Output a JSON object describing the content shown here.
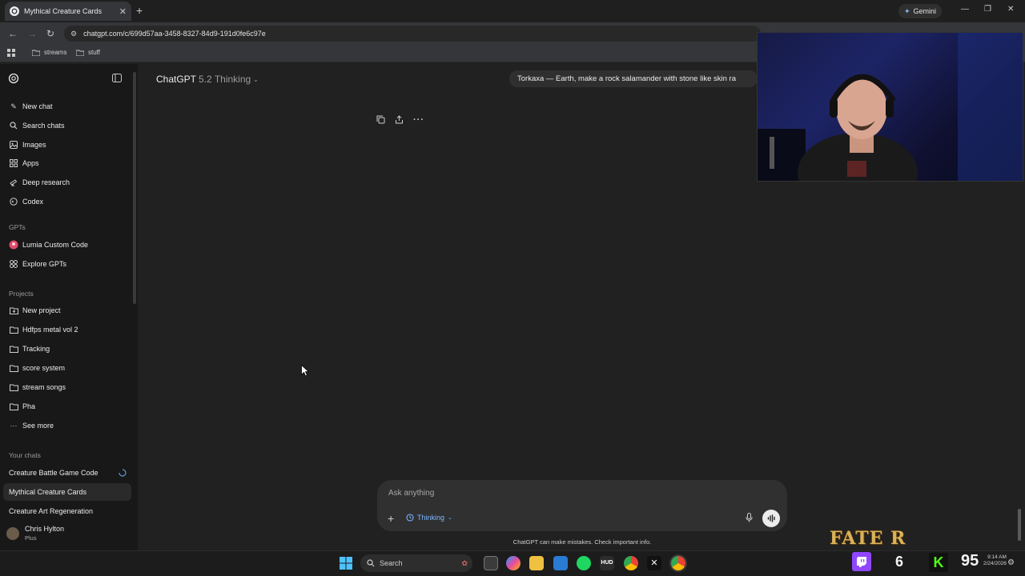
{
  "browser": {
    "tab_title": "Mythical Creature Cards",
    "gemini_label": "Gemini",
    "url": "chatgpt.com/c/699d57aa-3458-8327-84d9-191d0fe6c97e",
    "bookmarks": [
      "streams",
      "stuff"
    ]
  },
  "sidebar": {
    "nav": [
      {
        "label": "New chat",
        "icon": "edit-icon"
      },
      {
        "label": "Search chats",
        "icon": "search-icon"
      },
      {
        "label": "Images",
        "icon": "image-icon"
      },
      {
        "label": "Apps",
        "icon": "grid-icon"
      },
      {
        "label": "Deep research",
        "icon": "telescope-icon"
      },
      {
        "label": "Codex",
        "icon": "codex-icon"
      }
    ],
    "gpts_heading": "GPTs",
    "gpts": [
      {
        "label": "Lumia Custom Code",
        "icon": "lumia-icon"
      },
      {
        "label": "Explore GPTs",
        "icon": "explore-icon"
      }
    ],
    "projects_heading": "Projects",
    "projects": [
      {
        "label": "New project",
        "icon": "folder-plus-icon"
      },
      {
        "label": "Hdfps metal vol 2",
        "icon": "folder-icon"
      },
      {
        "label": "Tracking",
        "icon": "folder-icon"
      },
      {
        "label": "score system",
        "icon": "folder-icon"
      },
      {
        "label": "stream songs",
        "icon": "folder-icon"
      },
      {
        "label": "Pha",
        "icon": "folder-icon"
      },
      {
        "label": "See more",
        "icon": "more-icon"
      }
    ],
    "chats_heading": "Your chats",
    "chats": [
      {
        "label": "Creature Battle Game Code"
      },
      {
        "label": "Mythical Creature Cards"
      },
      {
        "label": "Creature Art Regeneration"
      }
    ],
    "user_name": "Chris Hylton",
    "user_plan": "Plus"
  },
  "main": {
    "model_name": "ChatGPT",
    "model_version": "5.2 Thinking",
    "chat_pill": "Torkaxa — Earth, make a rock salamander with stone like skin ra",
    "composer_placeholder": "Ask anything",
    "thinking_label": "Thinking",
    "disclaimer": "ChatGPT can make mistakes. Check important info."
  },
  "taskbar": {
    "search_label": "Search",
    "time": "9:14 AM",
    "date": "2/24/2026"
  },
  "overlay": {
    "logo_text": "FATE R",
    "counter": "6",
    "score": "95"
  }
}
